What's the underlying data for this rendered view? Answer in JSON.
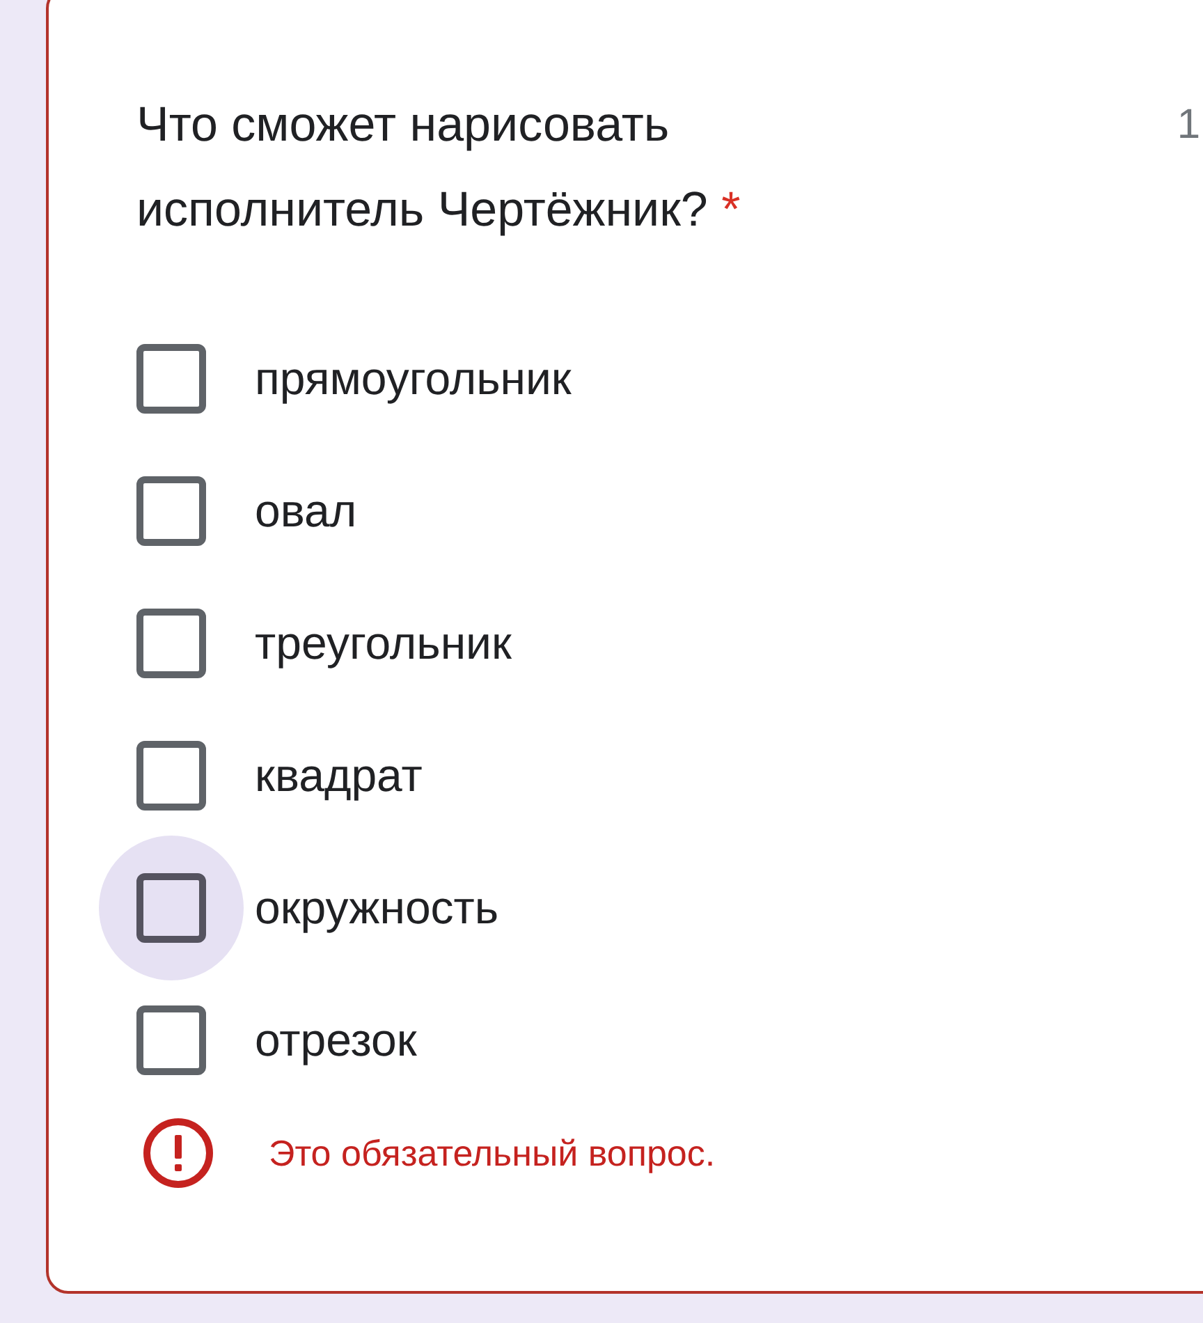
{
  "question": {
    "title": "Что сможет нарисовать исполнитель Чертёжник?",
    "required_mark": "*",
    "points": "1"
  },
  "options": [
    {
      "label": "прямоугольник",
      "checked": false,
      "hovered": false
    },
    {
      "label": "овал",
      "checked": false,
      "hovered": false
    },
    {
      "label": "треугольник",
      "checked": false,
      "hovered": false
    },
    {
      "label": "квадрат",
      "checked": false,
      "hovered": false
    },
    {
      "label": "окружность",
      "checked": false,
      "hovered": true
    },
    {
      "label": "отрезок",
      "checked": false,
      "hovered": false
    }
  ],
  "error": {
    "text": "Это обязательный вопрос."
  }
}
